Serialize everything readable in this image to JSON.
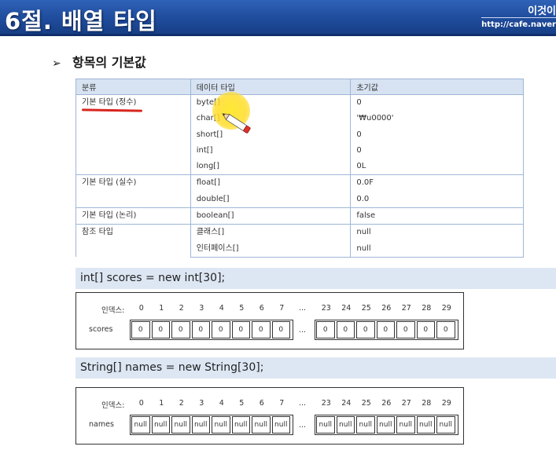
{
  "header": {
    "title": "6절. 배열 타입",
    "brand": "이것이",
    "url": "http://cafe.naver"
  },
  "section": {
    "heading": "항목의 기본값",
    "arrow": "➢"
  },
  "table": {
    "headers": [
      "분류",
      "데이터 타입",
      "초기값"
    ],
    "groups": [
      {
        "category": "기본 타입 (정수)",
        "rows": [
          {
            "type": "byte[]",
            "init": "0"
          },
          {
            "type": "char[]",
            "init": "'₩u0000'"
          },
          {
            "type": "short[]",
            "init": "0"
          },
          {
            "type": "int[]",
            "init": "0"
          },
          {
            "type": "long[]",
            "init": "0L"
          }
        ]
      },
      {
        "category": "기본 타입 (실수)",
        "rows": [
          {
            "type": "float[]",
            "init": "0.0F"
          },
          {
            "type": "double[]",
            "init": "0.0"
          }
        ]
      },
      {
        "category": "기본 타입 (논리)",
        "rows": [
          {
            "type": "boolean[]",
            "init": "false"
          }
        ]
      },
      {
        "category": "참조 타입",
        "rows": [
          {
            "type": "클래스[]",
            "init": "null"
          },
          {
            "type": "인터페이스[]",
            "init": "null"
          }
        ]
      }
    ]
  },
  "scores": {
    "code": "int[] scores = new int[30];",
    "index_label": "인덱스:",
    "row_label": "scores",
    "indices_left": [
      "0",
      "1",
      "2",
      "3",
      "4",
      "5",
      "6",
      "7"
    ],
    "indices_right": [
      "23",
      "24",
      "25",
      "26",
      "27",
      "28",
      "29"
    ],
    "values_left": [
      "0",
      "0",
      "0",
      "0",
      "0",
      "0",
      "0",
      "0"
    ],
    "values_right": [
      "0",
      "0",
      "0",
      "0",
      "0",
      "0",
      "0"
    ],
    "ellipsis": "..."
  },
  "names": {
    "code": "String[] names = new String[30];",
    "index_label": "인덱스:",
    "row_label": "names",
    "indices_left": [
      "0",
      "1",
      "2",
      "3",
      "4",
      "5",
      "6",
      "7"
    ],
    "indices_right": [
      "23",
      "24",
      "25",
      "26",
      "27",
      "28",
      "29"
    ],
    "values_left": [
      "null",
      "null",
      "null",
      "null",
      "null",
      "null",
      "null",
      "null"
    ],
    "values_right": [
      "null",
      "null",
      "null",
      "null",
      "null",
      "null",
      "null"
    ],
    "ellipsis": "..."
  }
}
